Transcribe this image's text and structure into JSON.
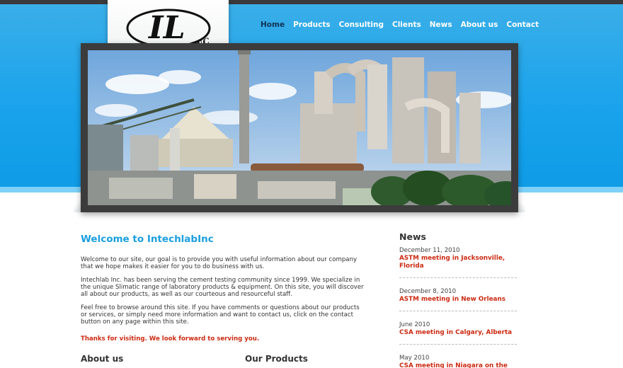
{
  "logo": {
    "text": "INTECHLAB INC",
    "monogram": "IL"
  },
  "nav": {
    "items": [
      {
        "label": "Home",
        "active": true
      },
      {
        "label": "Products"
      },
      {
        "label": "Consulting"
      },
      {
        "label": "Clients"
      },
      {
        "label": "News"
      },
      {
        "label": "About us"
      },
      {
        "label": "Contact"
      }
    ]
  },
  "main": {
    "title": "Welcome to IntechlabInc",
    "paragraphs": [
      "Welcome to our site, our goal is to provide you with useful information about our company that we hope makes it easier for you to do business with us.",
      "Intechlab Inc. has been serving the cement testing community since 1999. We specialize in the unique Slimatic range of laboratory products & equipment. On this site, you will discover all about our products, as well as our courteous and resourceful staff.",
      "Feel free to browse around this site. If you have comments or questions about our products or services, or simply need more information and want to contact us, click on the contact button on any page within this site."
    ],
    "thanks": "Thanks for visiting. We look forward to serving you."
  },
  "sections": {
    "about": "About us",
    "products": "Our Products"
  },
  "news": {
    "title": "News",
    "items": [
      {
        "date": "December 11, 2010",
        "title": "ASTM meeting in Jacksonville, Florida"
      },
      {
        "date": "December 8, 2010",
        "title": "ASTM meeting in New Orleans"
      },
      {
        "date": "June 2010",
        "title": "CSA meeting in Calgary, Alberta"
      },
      {
        "date": "May 2010",
        "title": "CSA meeting in Niagara on the"
      }
    ]
  },
  "colors": {
    "accent": "#1a9fe0",
    "link": "#cc2a12",
    "header": "#1aa3ec"
  },
  "icons": {
    "banner": "cement-plant-photo"
  }
}
